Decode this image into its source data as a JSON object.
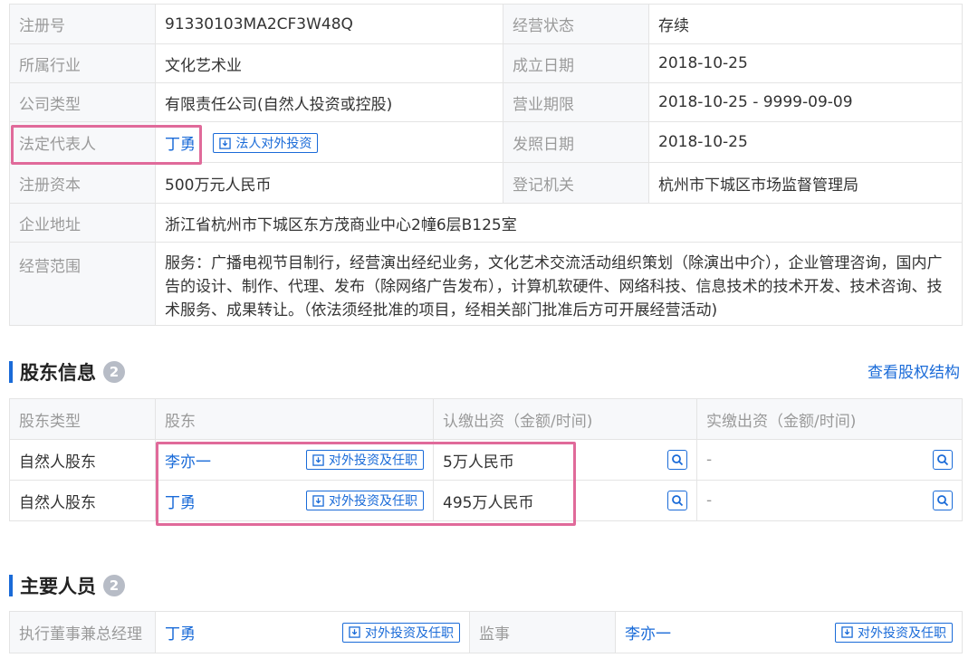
{
  "basic": {
    "reg_no_label": "注册号",
    "reg_no": "91330103MA2CF3W48Q",
    "status_label": "经营状态",
    "status": "存续",
    "industry_label": "所属行业",
    "industry": "文化艺术业",
    "found_label": "成立日期",
    "found_date": "2018-10-25",
    "type_label": "公司类型",
    "type": "有限责任公司(自然人投资或控股)",
    "term_label": "营业期限",
    "term": "2018-10-25 - 9999-09-09",
    "rep_label": "法定代表人",
    "rep": "丁勇",
    "rep_btn": "法人对外投资",
    "issue_label": "发照日期",
    "issue_date": "2018-10-25",
    "capital_label": "注册资本",
    "capital": "500万元人民币",
    "authority_label": "登记机关",
    "authority": "杭州市下城区市场监督管理局",
    "address_label": "企业地址",
    "address": "浙江省杭州市下城区东方茂商业中心2幢6层B125室",
    "scope_label": "经营范围",
    "scope": "服务：广播电视节目制行，经营演出经纪业务，文化艺术交流活动组织策划（除演出中介），企业管理咨询，国内广告的设计、制作、代理、发布（除网络广告发布），计算机软硬件、网络科技、信息技术的技术开发、技术咨询、技术服务、成果转让。（依法须经批准的项目，经相关部门批准后方可开展经营活动)"
  },
  "shareholders": {
    "title": "股东信息",
    "count": "2",
    "equity_link": "查看股权结构",
    "headers": [
      "股东类型",
      "股东",
      "认缴出资（金额/时间)",
      "实缴出资（金额/时间)"
    ],
    "rows": [
      {
        "type": "自然人股东",
        "name": "李亦一",
        "btn": "对外投资及任职",
        "subscribed": "5万人民币",
        "paid": "-"
      },
      {
        "type": "自然人股东",
        "name": "丁勇",
        "btn": "对外投资及任职",
        "subscribed": "495万人民币",
        "paid": "-"
      }
    ]
  },
  "personnel": {
    "title": "主要人员",
    "count": "2",
    "p1_role": "执行董事兼总经理",
    "p1_name": "丁勇",
    "p1_btn": "对外投资及任职",
    "p2_role": "监事",
    "p2_name": "李亦一",
    "p2_btn": "对外投资及任职"
  },
  "colors": {
    "accent": "#1a6bd8",
    "highlight": "#e06a9a",
    "label_bg": "#f7f8fa"
  }
}
